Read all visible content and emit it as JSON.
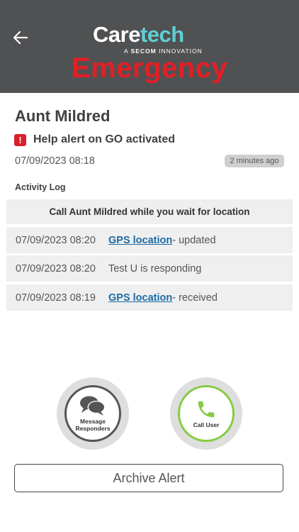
{
  "header": {
    "back_icon": "arrow-left-icon",
    "logo": {
      "part1": "Care",
      "part2": "tech",
      "sub_prefix": "A",
      "sub_brand": "SECOM",
      "sub_suffix": "INNOVATION"
    },
    "title": "Emergency",
    "background_color": "#505153",
    "title_color": "#e21f25"
  },
  "alert": {
    "name": "Aunt Mildred",
    "icon": "exclamation-icon",
    "message": "Help alert on GO activated",
    "timestamp": "07/09/2023 08:18",
    "ago": "2 minutes ago"
  },
  "activity_log": {
    "label": "Activity Log",
    "banner": "Call Aunt Mildred while you wait for location",
    "entries": [
      {
        "time": "07/09/2023 08:20",
        "link": "GPS location",
        "text": " - updated"
      },
      {
        "time": "07/09/2023 08:20",
        "link": "",
        "text": "Test U is responding"
      },
      {
        "time": "07/09/2023 08:19",
        "link": "GPS location",
        "text": " - received"
      }
    ]
  },
  "actions": {
    "message_line1": "Message",
    "message_line2": "Responders",
    "message_icon": "chat-bubbles-icon",
    "call_label": "Call User",
    "call_icon": "phone-icon",
    "call_accent": "#86cb42",
    "archive_label": "Archive Alert"
  },
  "link_color": "#1b6aa4"
}
